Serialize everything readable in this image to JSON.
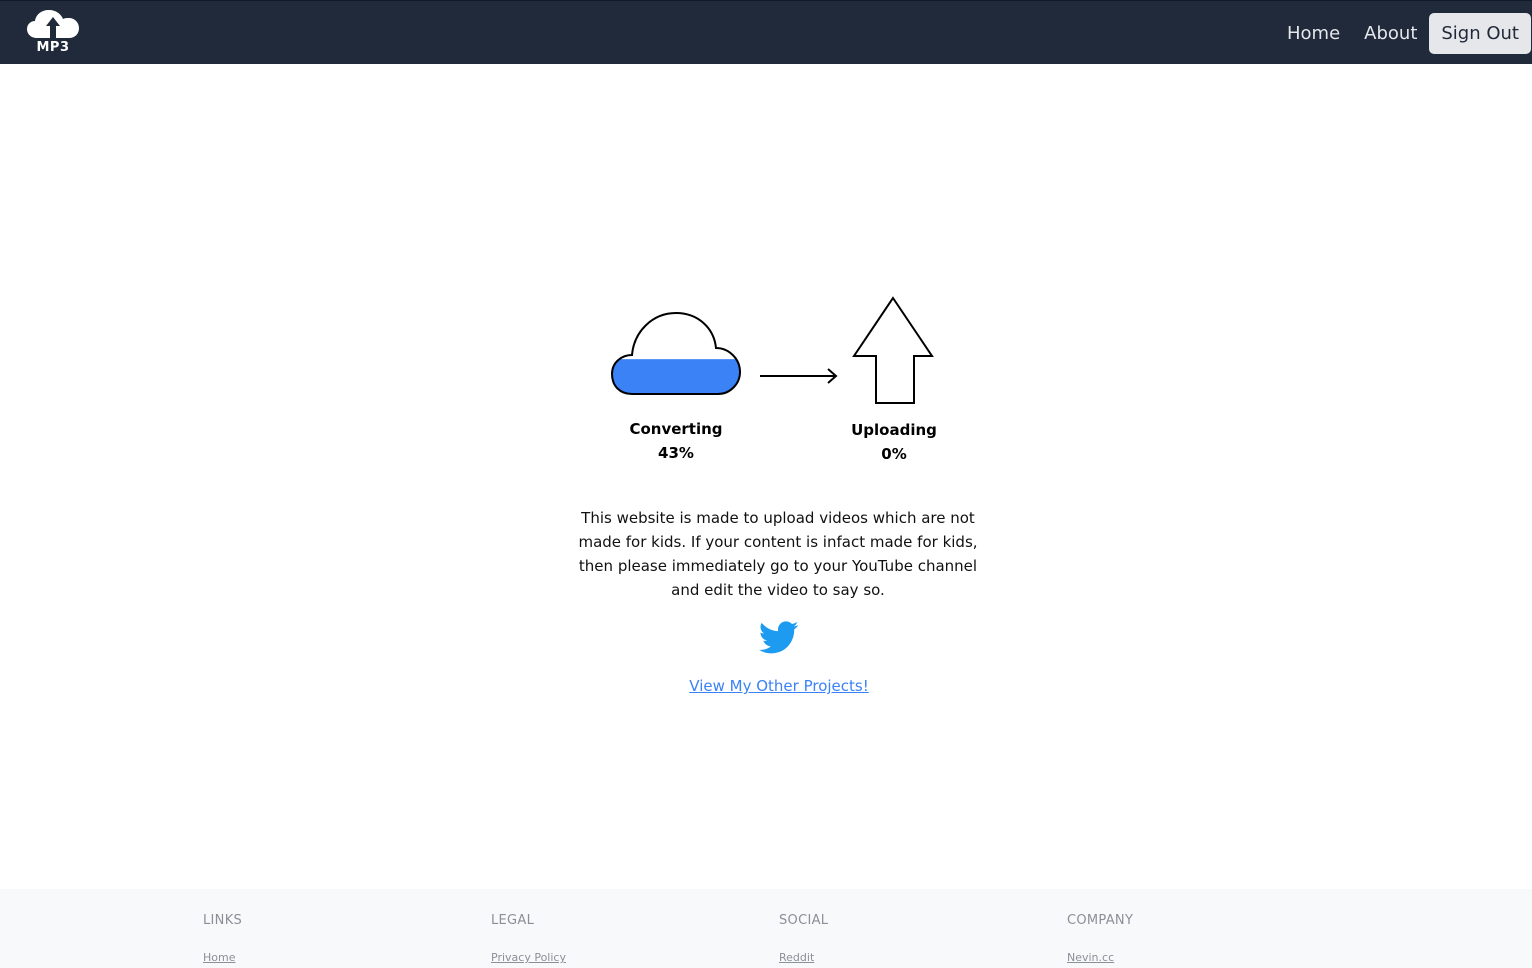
{
  "nav": {
    "logo_text": "MP3",
    "links": [
      "Home",
      "About"
    ],
    "signout_label": "Sign Out"
  },
  "progress": {
    "converting_label": "Converting",
    "converting_percent": "43%",
    "converting_fraction": 0.43,
    "uploading_label": "Uploading",
    "uploading_percent": "0%",
    "uploading_fraction": 0.0
  },
  "main": {
    "notice": "This website is made to upload videos which are not made for kids. If your content is infact made for kids, then please immediately go to your YouTube channel and edit the video to say so.",
    "twitter_icon": "twitter-bird-icon",
    "projects_link": "View My Other Projects!"
  },
  "colors": {
    "navbar": "#202a3b",
    "progress_fill": "#3b82f6",
    "twitter_blue": "#1d9bf0",
    "link": "#3b82f6"
  },
  "footer": {
    "columns": [
      {
        "heading": "LINKS",
        "link": "Home"
      },
      {
        "heading": "LEGAL",
        "link": "Privacy Policy"
      },
      {
        "heading": "SOCIAL",
        "link": "Reddit"
      },
      {
        "heading": "COMPANY",
        "link": "Nevin.cc"
      }
    ]
  }
}
